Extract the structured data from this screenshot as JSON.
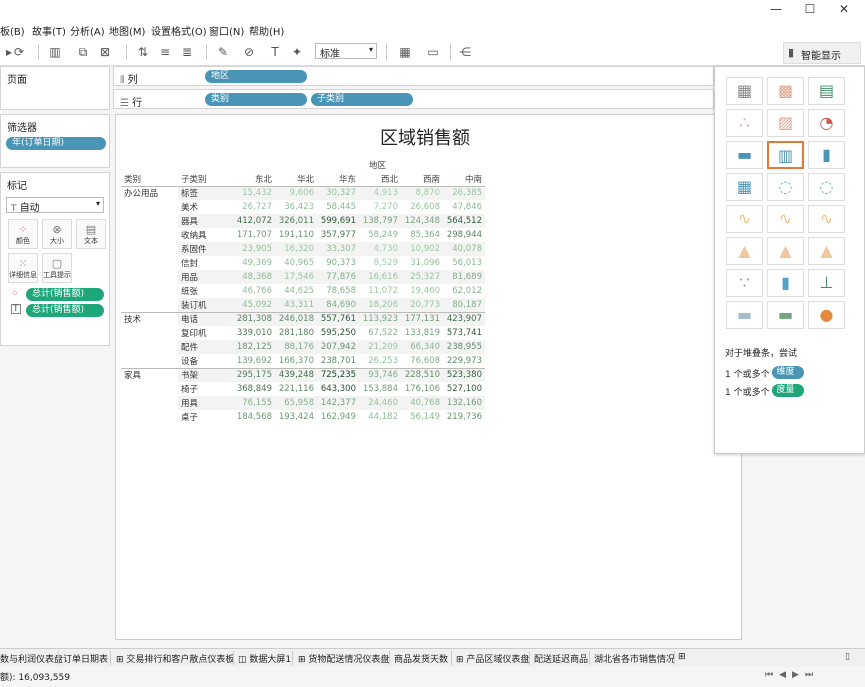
{
  "menu": [
    "板(B)",
    "故事(T)",
    "分析(A)",
    "地图(M)",
    "设置格式(O)",
    "窗口(N)",
    "帮助(H)"
  ],
  "toolbar": {
    "mark_dropdown": "标准",
    "smart_show": "智能显示"
  },
  "panels": {
    "pages": "页面",
    "filters": "筛选器",
    "marks": "标记",
    "filter_pill": "年(订单日期)"
  },
  "marks": {
    "type": "自动",
    "buttons": [
      "颜色",
      "大小",
      "文本",
      "详细信息",
      "工具提示"
    ],
    "pills": [
      "总计(销售额)",
      "总计(销售额)"
    ]
  },
  "shelves": {
    "columns_label": "列",
    "rows_label": "行",
    "columns_pills": [
      "地区"
    ],
    "rows_pills": [
      "类别",
      "子类别"
    ]
  },
  "view": {
    "title": "区域销售额",
    "col_group_header": "地区",
    "row_headers": [
      "类别",
      "子类别"
    ],
    "regions": [
      "东北",
      "华北",
      "华东",
      "西北",
      "西南",
      "中南"
    ],
    "categories": [
      {
        "name": "办公用品",
        "rows": [
          {
            "sub": "标签",
            "vals": [
              "15,432",
              "9,606",
              "30,327",
              "4,913",
              "8,870",
              "26,385"
            ]
          },
          {
            "sub": "美术",
            "vals": [
              "26,727",
              "36,423",
              "58,445",
              "7,270",
              "26,608",
              "47,846"
            ]
          },
          {
            "sub": "器具",
            "vals": [
              "412,072",
              "326,011",
              "599,691",
              "138,797",
              "124,348",
              "564,512"
            ]
          },
          {
            "sub": "收纳具",
            "vals": [
              "171,707",
              "191,110",
              "357,977",
              "58,249",
              "85,364",
              "298,944"
            ]
          },
          {
            "sub": "系固件",
            "vals": [
              "23,905",
              "16,320",
              "33,307",
              "4,730",
              "10,902",
              "40,078"
            ]
          },
          {
            "sub": "信封",
            "vals": [
              "49,369",
              "40,965",
              "90,373",
              "8,529",
              "31,096",
              "56,013"
            ]
          },
          {
            "sub": "用品",
            "vals": [
              "48,368",
              "17,546",
              "77,876",
              "16,616",
              "25,327",
              "81,689"
            ]
          },
          {
            "sub": "纸张",
            "vals": [
              "46,766",
              "44,625",
              "78,658",
              "11,072",
              "19,460",
              "62,012"
            ]
          },
          {
            "sub": "装订机",
            "vals": [
              "45,092",
              "43,311",
              "84,690",
              "18,206",
              "20,773",
              "80,187"
            ]
          }
        ]
      },
      {
        "name": "技术",
        "rows": [
          {
            "sub": "电话",
            "vals": [
              "281,308",
              "246,018",
              "557,761",
              "113,923",
              "177,131",
              "423,907"
            ]
          },
          {
            "sub": "复印机",
            "vals": [
              "339,010",
              "281,180",
              "595,250",
              "67,522",
              "133,819",
              "573,741"
            ]
          },
          {
            "sub": "配件",
            "vals": [
              "182,125",
              "88,176",
              "207,942",
              "21,209",
              "66,340",
              "238,955"
            ]
          },
          {
            "sub": "设备",
            "vals": [
              "139,692",
              "166,370",
              "238,701",
              "26,253",
              "76,608",
              "229,973"
            ]
          }
        ]
      },
      {
        "name": "家具",
        "rows": [
          {
            "sub": "书架",
            "vals": [
              "295,175",
              "439,248",
              "725,235",
              "93,746",
              "228,510",
              "523,380"
            ]
          },
          {
            "sub": "椅子",
            "vals": [
              "368,849",
              "221,116",
              "643,300",
              "153,884",
              "176,106",
              "527,100"
            ]
          },
          {
            "sub": "用具",
            "vals": [
              "76,155",
              "65,958",
              "142,377",
              "24,460",
              "40,768",
              "132,160"
            ]
          },
          {
            "sub": "桌子",
            "vals": [
              "184,568",
              "193,424",
              "162,949",
              "44,182",
              "56,149",
              "219,736"
            ]
          }
        ]
      }
    ]
  },
  "showme": {
    "hint": "对于堆叠条，尝试",
    "req1_prefix": "1 个或多个",
    "req1_pill": "维度",
    "req2_prefix": "1 个或多个",
    "req2_pill": "度量"
  },
  "tabs": [
    "数与利润仪表盘",
    "订单日期表",
    "交易排行和客户散点仪表板",
    "数据大屏1",
    "货物配送情况仪表盘",
    "商品发货天数",
    "产品区域仪表盘",
    "配送延迟商品",
    "湖北省各市销售情况"
  ],
  "status": {
    "sum": "额): 16,093,559"
  },
  "colors": {
    "pill_dim": "#4a95b5",
    "pill_measure": "#1fa67a",
    "selected_chart": "#e07a3b"
  }
}
